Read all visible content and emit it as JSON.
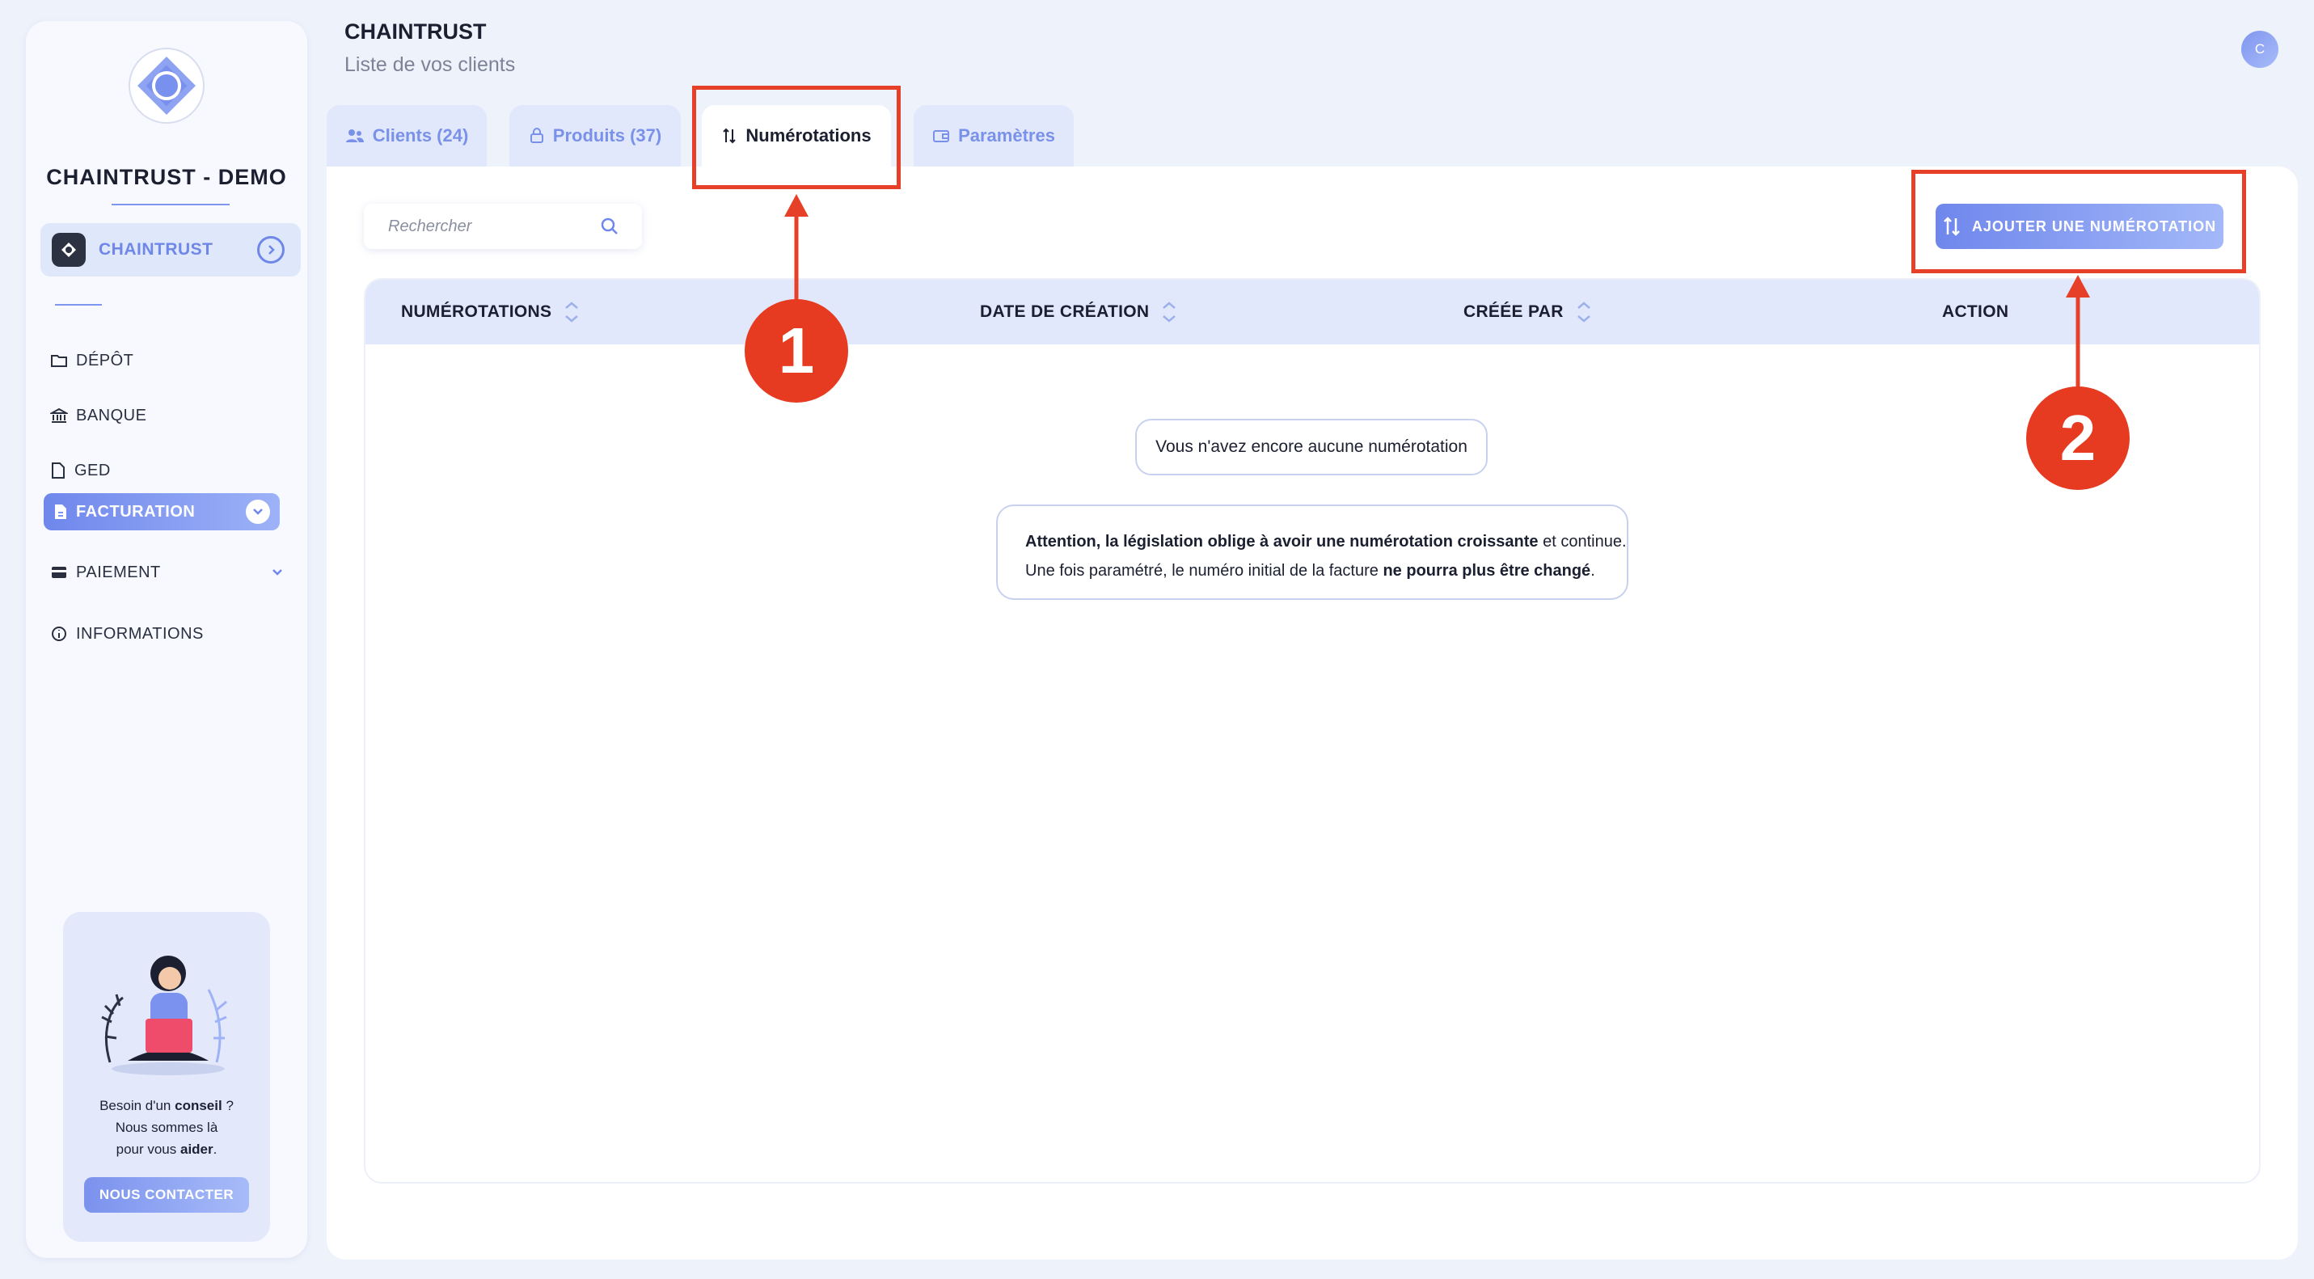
{
  "sidebar": {
    "brand": "CHAINTRUST - DEMO",
    "org_label": "CHAINTRUST",
    "nav": [
      {
        "label": "DÉPÔT",
        "icon": "folder-icon"
      },
      {
        "label": "BANQUE",
        "icon": "bank-icon"
      },
      {
        "label": "GED",
        "icon": "document-icon"
      },
      {
        "label": "FACTURATION",
        "icon": "invoice-icon",
        "active": true
      },
      {
        "label": "PAIEMENT",
        "icon": "card-icon"
      },
      {
        "label": "INFORMATIONS",
        "icon": "info-icon"
      }
    ],
    "help": {
      "line1_a": "Besoin d'un ",
      "line1_b": "conseil",
      "line1_c": " ?",
      "line2": "Nous sommes là",
      "line3_a": "pour vous ",
      "line3_b": "aider",
      "line3_c": ".",
      "button": "NOUS CONTACTER"
    }
  },
  "header": {
    "title": "CHAINTRUST",
    "subtitle": "Liste de vos clients",
    "avatar_initial": "C"
  },
  "tabs": [
    {
      "label": "Clients (24)",
      "icon": "users-icon"
    },
    {
      "label": "Produits (37)",
      "icon": "box-icon"
    },
    {
      "label": "Numérotations",
      "icon": "sort-arrows-icon",
      "active": true
    },
    {
      "label": "Paramètres",
      "icon": "wallet-icon"
    }
  ],
  "toolbar": {
    "search_placeholder": "Rechercher",
    "add_button": "AJOUTER UNE NUMÉROTATION"
  },
  "table": {
    "columns": [
      "NUMÉROTATIONS",
      "DATE DE CRÉATION",
      "CRÉÉE PAR",
      "ACTION"
    ],
    "empty_message": "Vous n'avez encore aucune numérotation"
  },
  "notice": {
    "bold1": "Attention, la législation oblige à avoir une numérotation croissante",
    "rest1": " et continue.",
    "line2_a": "Une fois paramétré, le numéro initial de la facture ",
    "line2_bold": "ne pourra plus être changé",
    "line2_c": "."
  },
  "annotations": {
    "badge1": "1",
    "badge2": "2"
  },
  "colors": {
    "accent": "#6f87ec",
    "annotation": "#e63b21",
    "background": "#eef2fb"
  }
}
